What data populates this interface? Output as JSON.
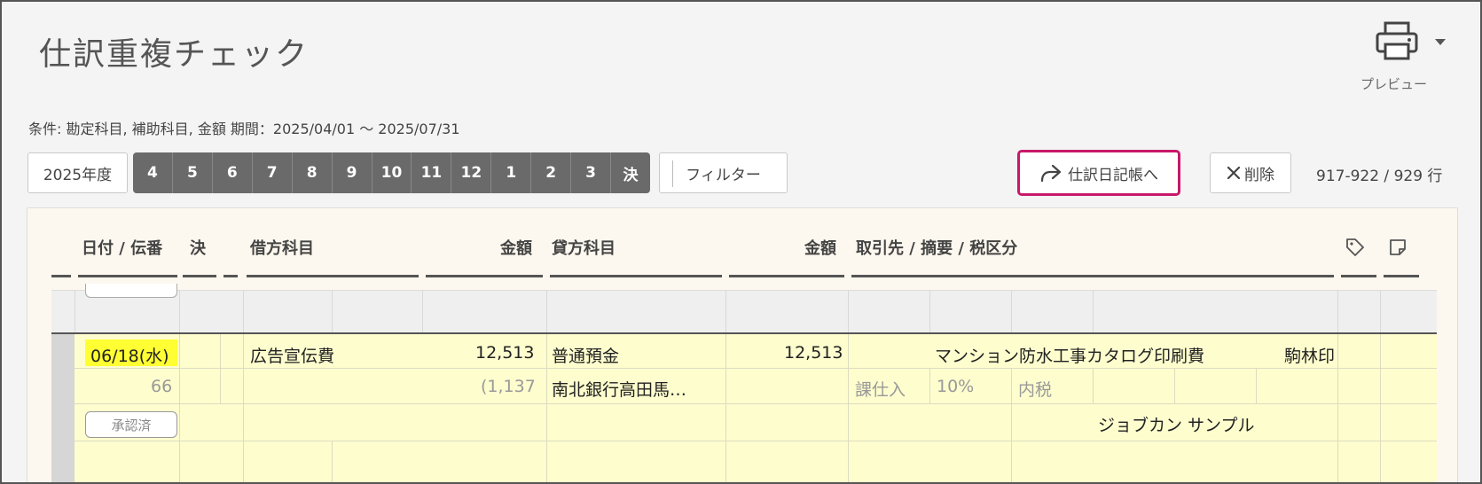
{
  "header": {
    "title": "仕訳重複チェック",
    "preview_label": "プレビュー"
  },
  "conditions": "条件: 勘定科目, 補助科目, 金額 期間：2025/04/01 ～ 2025/07/31",
  "toolbar": {
    "fiscal_year": "2025年度",
    "months": [
      "4",
      "5",
      "6",
      "7",
      "8",
      "9",
      "10",
      "11",
      "12",
      "1",
      "2",
      "3",
      "決"
    ],
    "filter_label": "フィルター",
    "journal_label": "仕訳日記帳へ",
    "delete_label": "削除",
    "row_count": "917-922 / 929 行"
  },
  "columns": {
    "date_slip": "日付 / 伝番",
    "settle": "決",
    "debit_account": "借方科目",
    "debit_amount": "金額",
    "credit_account": "貸方科目",
    "credit_amount": "金額",
    "partner_memo_tax": "取引先 / 摘要 / 税区分"
  },
  "entry": {
    "date": "06/18(水)",
    "slip_no": "66",
    "status": "承認済",
    "debit_account": "広告宣伝費",
    "debit_amount": "12,513",
    "debit_tax": "(1,137",
    "credit_account": "普通預金",
    "credit_sub": "南北銀行高田馬…",
    "credit_amount": "12,513",
    "memo": "マンション防水工事カタログ印刷費",
    "partner": "駒林印",
    "tax_category": "課仕入",
    "tax_rate": "10%",
    "tax_type": "内税",
    "creator": "ジョブカン サンプル"
  },
  "colors": {
    "accent_border": "#c8186a",
    "month_bar": "#6a6a6a",
    "date_highlight": "#ffff33",
    "entry_background": "#fdfdce"
  }
}
